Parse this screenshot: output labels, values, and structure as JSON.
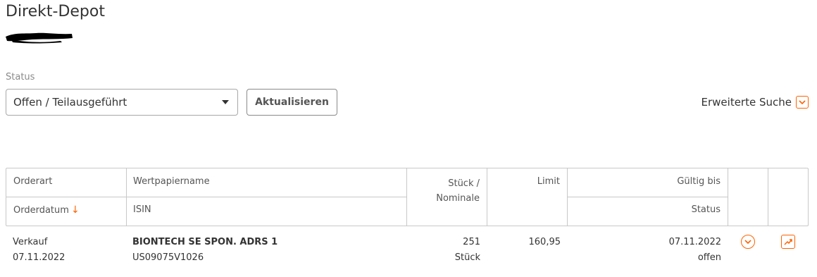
{
  "page": {
    "title": "Direkt-Depot"
  },
  "filter": {
    "status_label": "Status",
    "status_value": "Offen / Teilausgeführt",
    "refresh_label": "Aktualisieren",
    "advanced_search_label": "Erweiterte Suche"
  },
  "table": {
    "headers": {
      "orderart": "Orderart",
      "orderdatum": "Orderdatum",
      "wertpapiername": "Wertpapiername",
      "isin": "ISIN",
      "stueck_line1": "Stück /",
      "stueck_line2": "Nominale",
      "limit": "Limit",
      "gueltig_bis": "Gültig bis",
      "status": "Status"
    },
    "rows": [
      {
        "orderart": "Verkauf",
        "orderdatum": "07.11.2022",
        "wertpapiername": "BIONTECH SE SPON. ADRS 1",
        "isin": "US09075V1026",
        "stueck": "251",
        "einheit": "Stück",
        "limit": "160,95",
        "gueltig_bis": "07.11.2022",
        "status": "offen"
      }
    ]
  },
  "colors": {
    "accent": "#ff6200",
    "border": "#c8c8c8"
  },
  "icons": {
    "dropdown": "caret-down-icon",
    "advanced": "chevron-down-icon",
    "details": "chevron-down-icon",
    "chart": "trend-up-icon"
  }
}
